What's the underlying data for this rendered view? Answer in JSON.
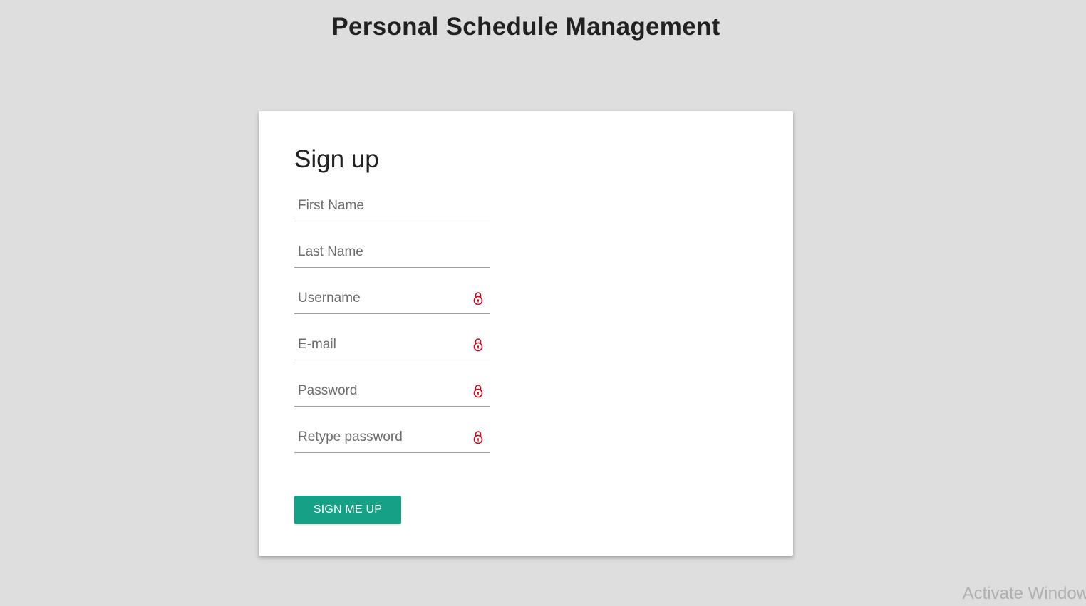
{
  "header": {
    "title": "Personal Schedule Management"
  },
  "form": {
    "title": "Sign up",
    "fields": {
      "first_name": {
        "placeholder": "First Name",
        "value": ""
      },
      "last_name": {
        "placeholder": "Last Name",
        "value": ""
      },
      "username": {
        "placeholder": "Username",
        "value": ""
      },
      "email": {
        "placeholder": "E-mail",
        "value": ""
      },
      "password": {
        "placeholder": "Password",
        "value": ""
      },
      "retype_password": {
        "placeholder": "Retype password",
        "value": ""
      }
    },
    "submit_label": "SIGN ME UP",
    "required_icon": "lock-icon"
  },
  "watermark": {
    "text": "Activate Window"
  },
  "colors": {
    "background": "#dedede",
    "card": "#ffffff",
    "accent": "#16a085",
    "required_icon": "#d0021b"
  }
}
